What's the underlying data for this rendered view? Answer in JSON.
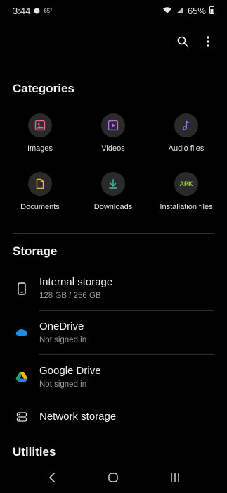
{
  "status": {
    "time": "3:44",
    "temperature": "65°",
    "battery": "65%",
    "icons": [
      "alert-icon",
      "wifi-icon",
      "signal-icon",
      "battery-icon"
    ]
  },
  "toolbar": {
    "icons": [
      "search-icon",
      "more-options-icon"
    ]
  },
  "categories": {
    "title": "Categories",
    "items": [
      {
        "label": "Images",
        "icon": "images-icon",
        "color": "#e06a8c"
      },
      {
        "label": "Videos",
        "icon": "videos-icon",
        "color": "#b76ae8"
      },
      {
        "label": "Audio files",
        "icon": "audio-icon",
        "color": "#8a8ae8"
      },
      {
        "label": "Documents",
        "icon": "documents-icon",
        "color": "#f0b046"
      },
      {
        "label": "Downloads",
        "icon": "downloads-icon",
        "color": "#4fb7a8"
      },
      {
        "label": "Installation files",
        "icon": "apk-icon",
        "icon_text": "APK",
        "color": "#9ccf3c"
      }
    ]
  },
  "storage": {
    "title": "Storage",
    "items": [
      {
        "title": "Internal storage",
        "subtitle": "128 GB / 256 GB",
        "icon": "phone-icon"
      },
      {
        "title": "OneDrive",
        "subtitle": "Not signed in",
        "icon": "onedrive-icon"
      },
      {
        "title": "Google Drive",
        "subtitle": "Not signed in",
        "icon": "google-drive-icon"
      },
      {
        "title": "Network storage",
        "subtitle": "",
        "icon": "network-storage-icon"
      }
    ]
  },
  "utilities": {
    "title": "Utilities"
  },
  "nav": {
    "icons": [
      "back-icon",
      "home-icon",
      "recents-icon"
    ]
  }
}
